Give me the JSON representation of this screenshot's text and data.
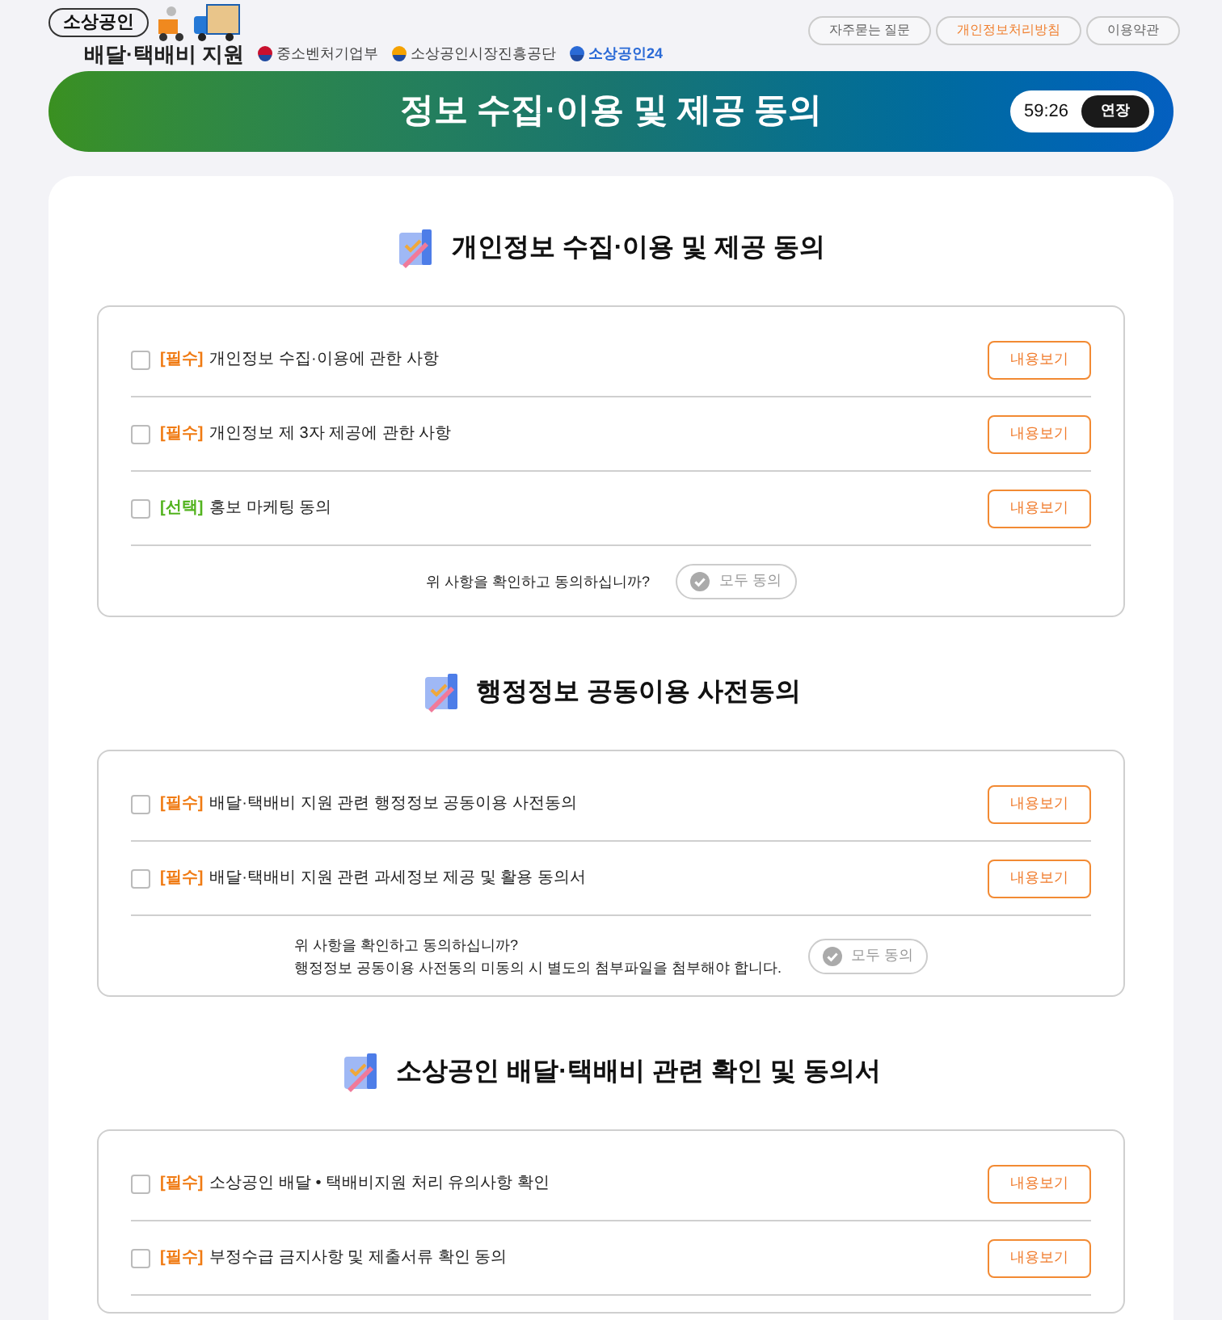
{
  "logo": {
    "badge": "소상공인",
    "title": "배달·택배비 지원"
  },
  "partners": [
    {
      "name": "중소벤처기업부"
    },
    {
      "name": "소상공인시장진흥공단"
    },
    {
      "name": "소상공인24"
    }
  ],
  "top_links": [
    {
      "label": "자주묻는 질문",
      "highlight": false
    },
    {
      "label": "개인정보처리방침",
      "highlight": true
    },
    {
      "label": "이용약관",
      "highlight": false
    }
  ],
  "banner": {
    "title": "정보 수집·이용 및 제공 동의",
    "timer": "59:26",
    "extend_button": "연장"
  },
  "sections": [
    {
      "title": "개인정보 수집·이용 및 제공 동의",
      "items": [
        {
          "checked": false,
          "kind": "required",
          "tag": "[필수]",
          "label": "개인정보 수집·이용에 관한 사항",
          "button": "내용보기"
        },
        {
          "checked": false,
          "kind": "required",
          "tag": "[필수]",
          "label": "개인정보 제 3자 제공에 관한 사항",
          "button": "내용보기"
        },
        {
          "checked": false,
          "kind": "optional",
          "tag": "[선택]",
          "label": "홍보 마케팅 동의",
          "button": "내용보기"
        }
      ],
      "footer": {
        "lines": [
          "위 사항을 확인하고 동의하십니까?"
        ],
        "button": "모두 동의"
      }
    },
    {
      "title": "행정정보 공동이용 사전동의",
      "items": [
        {
          "checked": false,
          "kind": "required",
          "tag": "[필수]",
          "label": "배달·택배비 지원 관련 행정정보 공동이용 사전동의",
          "button": "내용보기"
        },
        {
          "checked": false,
          "kind": "required",
          "tag": "[필수]",
          "label": "배달·택배비 지원 관련 과세정보 제공 및 활용 동의서",
          "button": "내용보기"
        }
      ],
      "footer": {
        "lines": [
          "위 사항을 확인하고 동의하십니까?",
          "행정정보 공동이용 사전동의 미동의 시 별도의 첨부파일을 첨부해야 합니다."
        ],
        "button": "모두 동의"
      }
    },
    {
      "title": "소상공인 배달·택배비 관련 확인 및 동의서",
      "items": [
        {
          "checked": false,
          "kind": "required",
          "tag": "[필수]",
          "label": "소상공인 배달 • 택배비지원 처리 유의사항 확인",
          "button": "내용보기"
        },
        {
          "checked": false,
          "kind": "required",
          "tag": "[필수]",
          "label": "부정수급 금지사항 및 제출서류 확인 동의",
          "button": "내용보기"
        }
      ]
    }
  ]
}
